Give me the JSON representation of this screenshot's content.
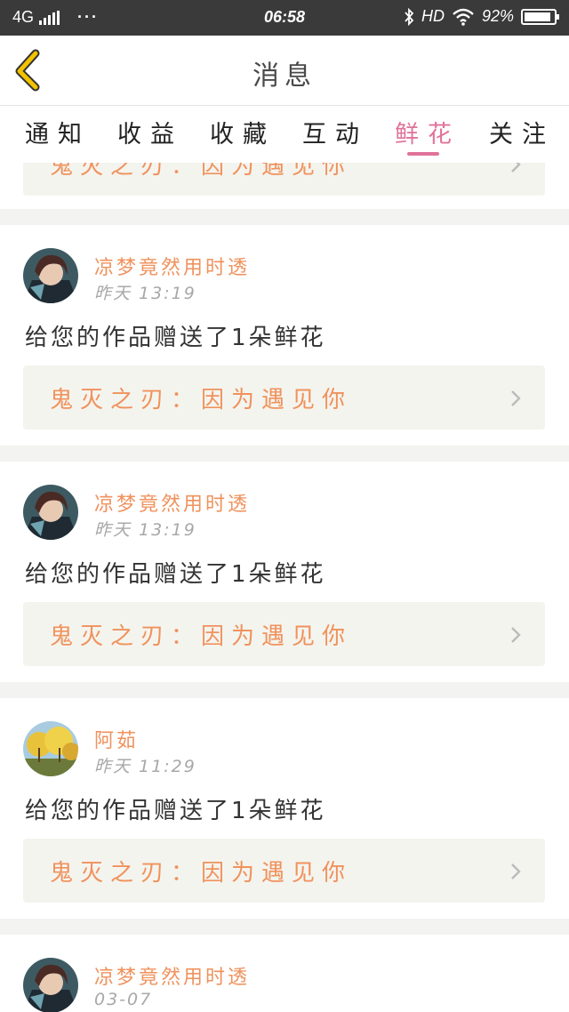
{
  "status_bar": {
    "network": "4G",
    "menu": "···",
    "time": "06:58",
    "hd": "HD",
    "battery": "92%",
    "battery_level": 0.92
  },
  "header": {
    "title": "消息",
    "back_icon": "chevron-left-icon",
    "accent": "#f2c200"
  },
  "tabs": [
    {
      "label": "通知",
      "active": false
    },
    {
      "label": "收益",
      "active": false
    },
    {
      "label": "收藏",
      "active": false
    },
    {
      "label": "互动",
      "active": false
    },
    {
      "label": "鲜花",
      "active": true
    },
    {
      "label": "关注",
      "active": false
    }
  ],
  "colors": {
    "accent": "#e0739a",
    "name": "#f0925d",
    "work_bg": "#f4f4ee"
  },
  "messages": [
    {
      "work_title": "鬼灭之刃：因为遇见你",
      "avatar": "anime-warrior"
    },
    {
      "user": "凉梦竟然用时透",
      "time": "昨天 13:19",
      "text": "给您的作品赠送了1朵鲜花",
      "work_title": "鬼灭之刃：因为遇见你",
      "avatar": "anime-warrior"
    },
    {
      "user": "凉梦竟然用时透",
      "time": "昨天 13:19",
      "text": "给您的作品赠送了1朵鲜花",
      "work_title": "鬼灭之刃：因为遇见你",
      "avatar": "anime-warrior"
    },
    {
      "user": "阿茹",
      "time": "昨天 11:29",
      "text": "给您的作品赠送了1朵鲜花",
      "work_title": "鬼灭之刃：因为遇见你",
      "avatar": "autumn-trees"
    },
    {
      "user": "凉梦竟然用时透",
      "time": "03-07",
      "avatar": "anime-warrior"
    }
  ]
}
